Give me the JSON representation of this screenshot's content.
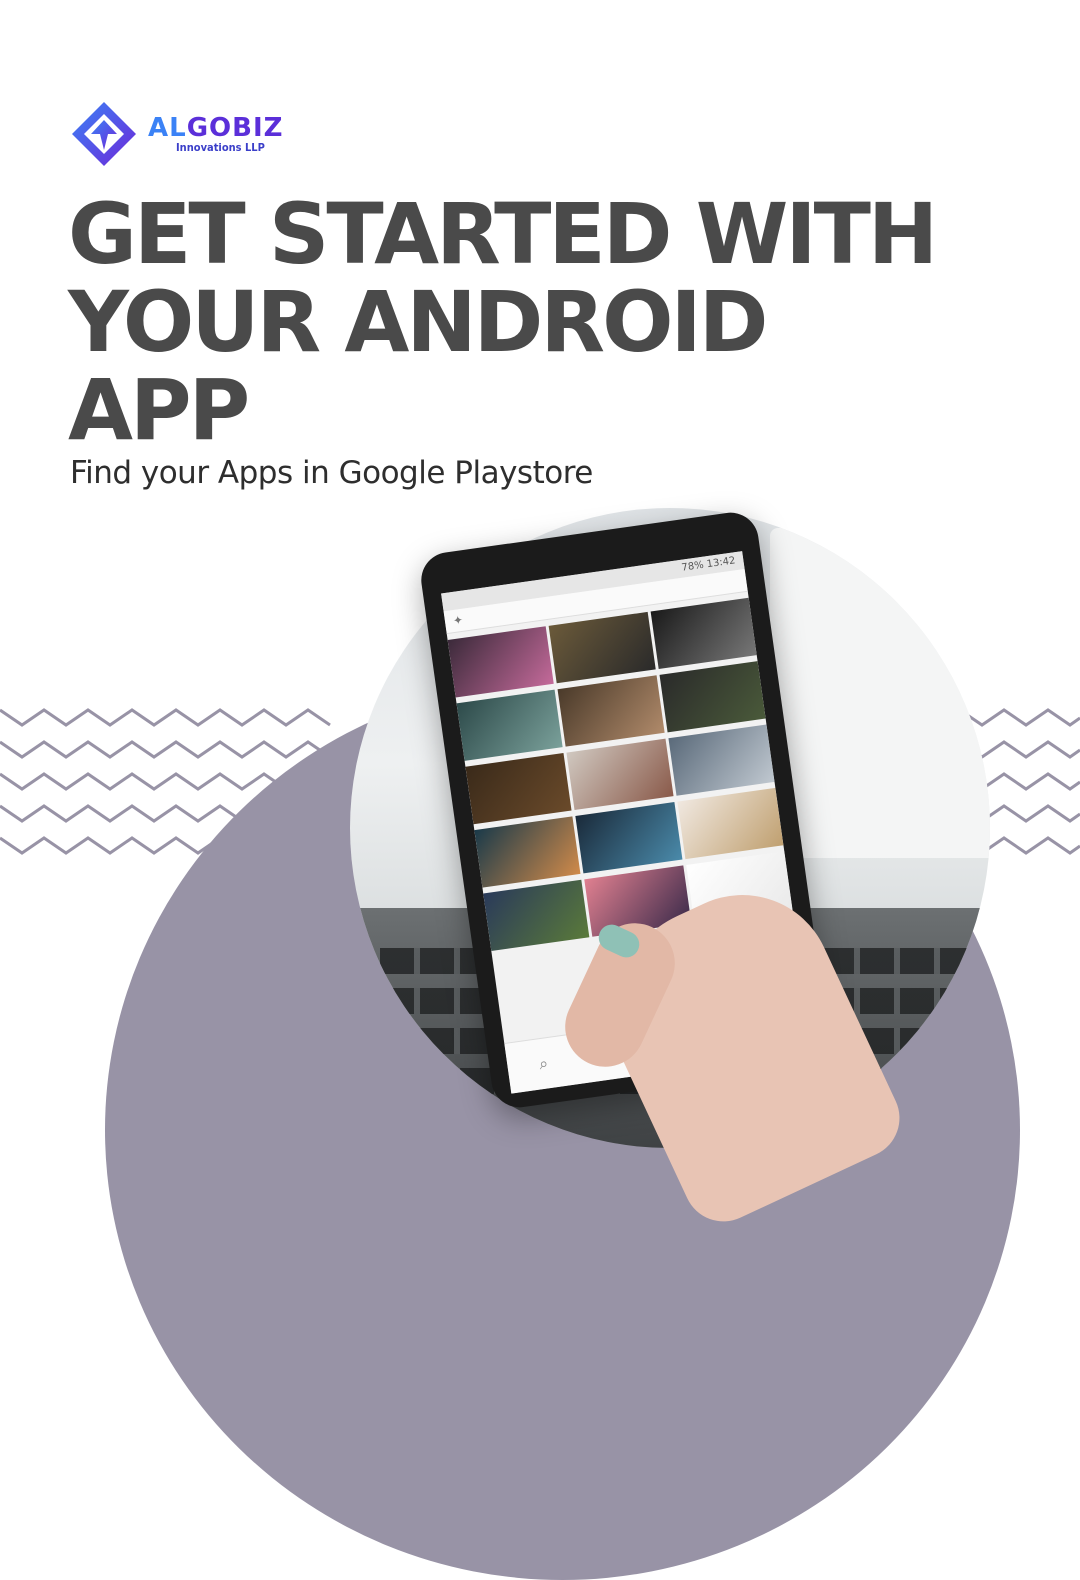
{
  "brand": {
    "name_part1": "AL",
    "name_part2": "GOBIZ",
    "subtitle": "Innovations LLP"
  },
  "headline": {
    "line1": "GET STARTED WITH",
    "line2": "YOUR ANDROID",
    "line3": "APP"
  },
  "subtitle": "Find your Apps in Google Playstore",
  "phone_screen": {
    "status_text": "78%  13:42"
  },
  "colors": {
    "headline": "#4a4a4a",
    "blob": "#9893a6",
    "zigzag": "#9893a6",
    "brand_primary": "#5b2fd9",
    "brand_accent": "#3b82f6"
  },
  "icons": {
    "logo": "algobiz-diamond-logo",
    "phone_nav": [
      "search-icon",
      "plus-icon",
      "heart-icon",
      "avatar-icon"
    ],
    "system_nav": [
      "back-icon",
      "home-icon",
      "menu-icon"
    ]
  }
}
